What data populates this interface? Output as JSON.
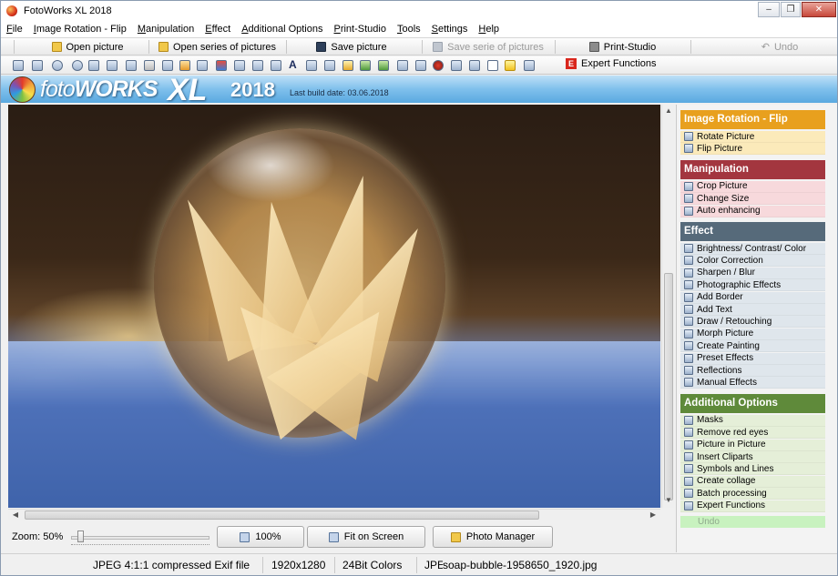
{
  "window": {
    "title": "FotoWorks XL 2018"
  },
  "menu": [
    "File",
    "Image Rotation - Flip",
    "Manipulation",
    "Effect",
    "Additional Options",
    "Print-Studio",
    "Tools",
    "Settings",
    "Help"
  ],
  "toolbar": {
    "open_picture": "Open picture",
    "open_series": "Open series of pictures",
    "save_picture": "Save picture",
    "save_series": "Save serie of pictures",
    "print_studio": "Print-Studio",
    "undo": "Undo",
    "expert_functions": "Expert Functions"
  },
  "banner": {
    "brand_foto": "foto",
    "brand_works": "WORKS",
    "brand_xl": "XL",
    "brand_year": "2018",
    "build": "Last build date: 03.06.2018"
  },
  "bottom": {
    "zoom_label": "Zoom: 50%",
    "zoom_fraction": 0.05,
    "btn_100": "100%",
    "btn_fit": "Fit on Screen",
    "btn_manager": "Photo Manager"
  },
  "status": {
    "format": "JPEG 4:1:1 compressed Exif file",
    "dimensions": "1920x1280",
    "colors": "24Bit Colors",
    "file_type": "JPEG",
    "filename": "soap-bubble-1958650_1920.jpg"
  },
  "sidebar": {
    "categories": [
      {
        "label": "Image Rotation - Flip",
        "color": "#e8a01e",
        "items": [
          "Rotate Picture",
          "Flip Picture"
        ],
        "bg": "#fbeaba"
      },
      {
        "label": "Manipulation",
        "color": "#a3363f",
        "items": [
          "Crop Picture",
          "Change Size",
          "Auto enhancing"
        ],
        "bg": "#f7d9dc"
      },
      {
        "label": "Effect",
        "color": "#566a7a",
        "items": [
          "Brightness/ Contrast/ Color",
          "Color Correction",
          "Sharpen / Blur",
          "Photographic Effects",
          "Add Border",
          "Add Text",
          "Draw / Retouching",
          "Morph Picture",
          "Create Painting",
          "Preset Effects",
          "Reflections",
          "Manual Effects"
        ],
        "bg": "#dfe6ec"
      },
      {
        "label": "Additional Options",
        "color": "#5f8a3a",
        "items": [
          "Masks",
          "Remove red eyes",
          "Picture in Picture",
          "Insert Cliparts",
          "Symbols and Lines",
          "Create collage",
          "Batch processing",
          "Expert Functions"
        ],
        "bg": "#e5efd8"
      }
    ],
    "undo": "Undo"
  }
}
